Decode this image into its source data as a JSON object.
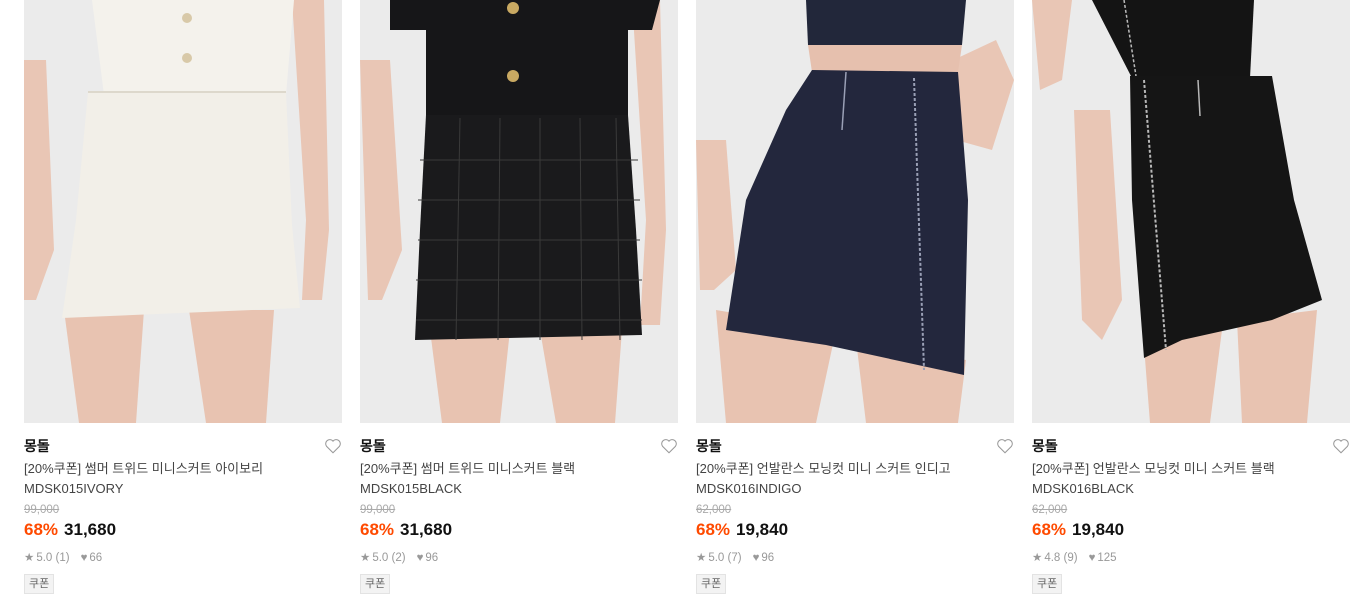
{
  "products": [
    {
      "brand": "몽돌",
      "title": "[20%쿠폰] 썸머 트위드 미니스커트 아이보리",
      "code": "MDSK015IVORY",
      "original_price": "99,000",
      "discount": "68%",
      "price": "31,680",
      "rating": "5.0 (1)",
      "likes": "66",
      "coupon_badge": "쿠폰",
      "skirt_color": "#f2efe8",
      "top_color": "#f4f2ec"
    },
    {
      "brand": "몽돌",
      "title": "[20%쿠폰] 썸머 트위드 미니스커트 블랙",
      "code": "MDSK015BLACK",
      "original_price": "99,000",
      "discount": "68%",
      "price": "31,680",
      "rating": "5.0 (2)",
      "likes": "96",
      "coupon_badge": "쿠폰",
      "skirt_color": "#1a1a1c",
      "top_color": "#161618"
    },
    {
      "brand": "몽돌",
      "title": "[20%쿠폰] 언발란스 모닝컷 미니 스커트 인디고",
      "code": "MDSK016INDIGO",
      "original_price": "62,000",
      "discount": "68%",
      "price": "19,840",
      "rating": "5.0 (7)",
      "likes": "96",
      "coupon_badge": "쿠폰",
      "skirt_color": "#23273d",
      "top_color": "#22273a"
    },
    {
      "brand": "몽돌",
      "title": "[20%쿠폰] 언발란스 모닝컷 미니 스커트 블랙",
      "code": "MDSK016BLACK",
      "original_price": "62,000",
      "discount": "68%",
      "price": "19,840",
      "rating": "4.8 (9)",
      "likes": "125",
      "coupon_badge": "쿠폰",
      "skirt_color": "#151515",
      "top_color": "#141414"
    }
  ],
  "colors": {
    "discount": "#ff4a00",
    "photo_bg": "#ededed",
    "skin": "#e6c0ae"
  }
}
